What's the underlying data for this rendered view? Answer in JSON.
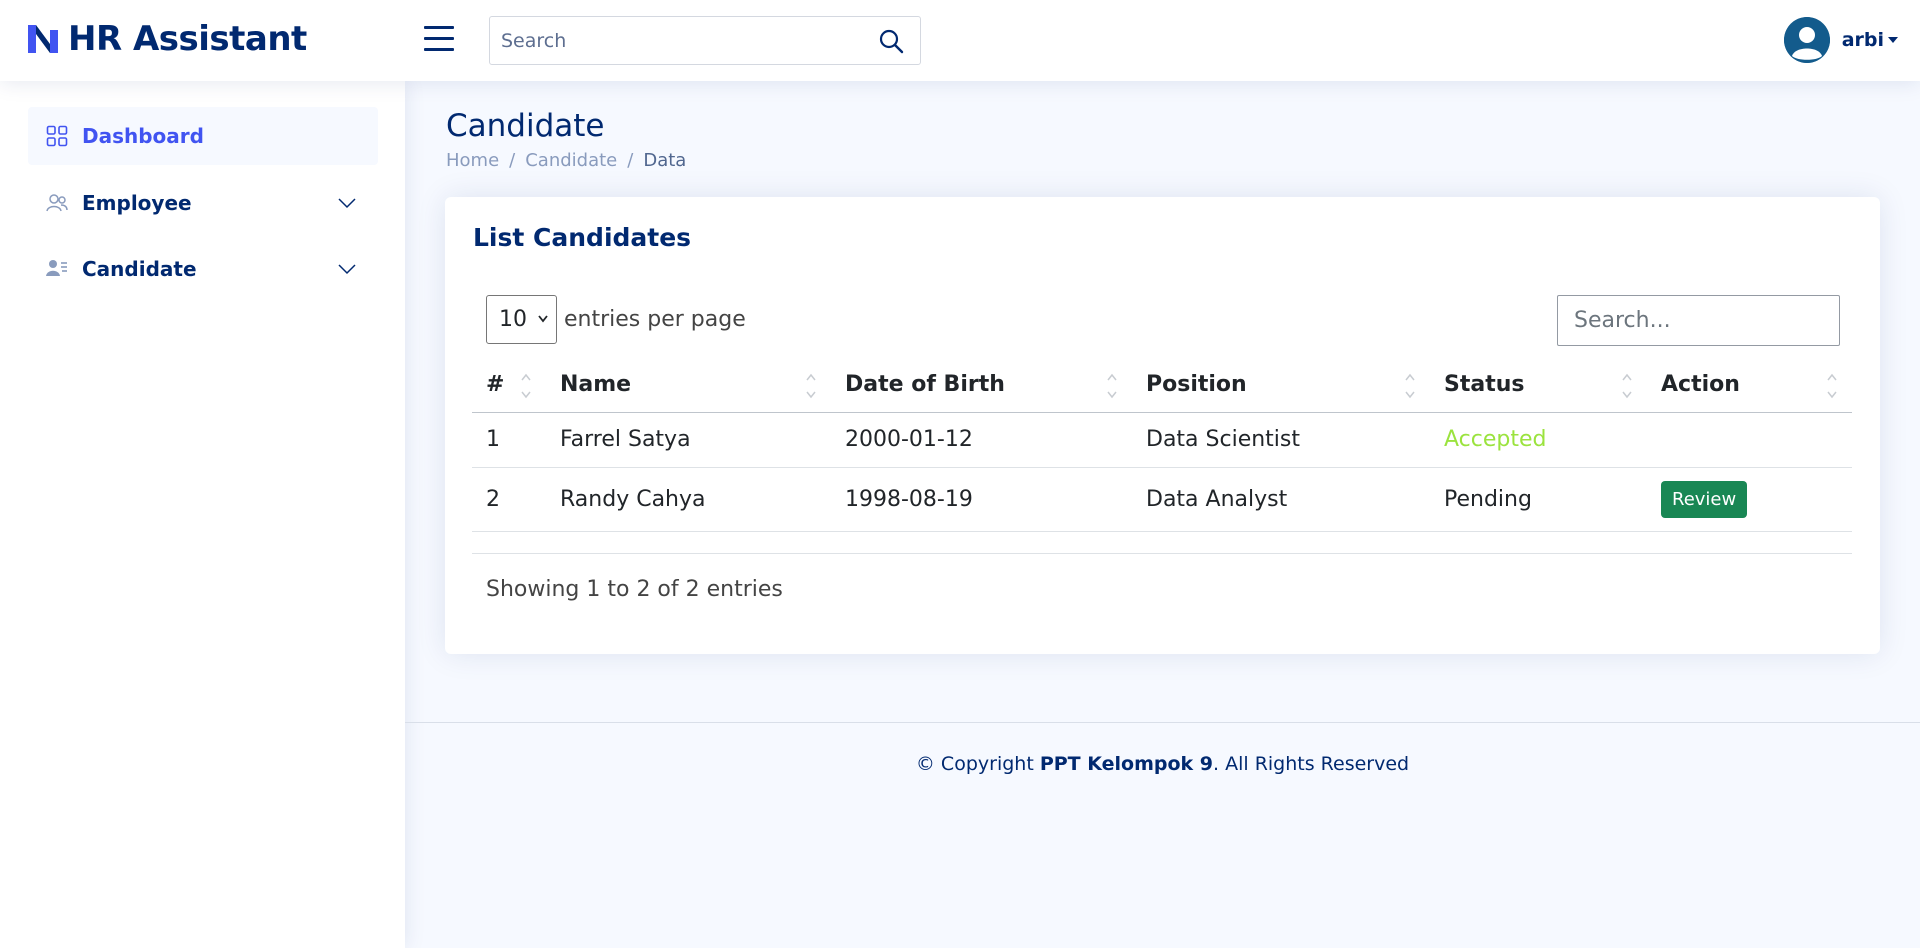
{
  "app": {
    "name": "HR Assistant",
    "brand_color": "#4154f1",
    "text_color": "#012970"
  },
  "header": {
    "search_placeholder": "Search",
    "search_icon": "search-icon",
    "menu_icon": "hamburger-icon",
    "user_name": "arbi"
  },
  "sidebar": {
    "items": [
      {
        "label": "Dashboard",
        "icon": "grid-icon",
        "active": true
      },
      {
        "label": "Employee",
        "icon": "people-icon",
        "expandable": true
      },
      {
        "label": "Candidate",
        "icon": "person-lines-icon",
        "expandable": true
      }
    ]
  },
  "page": {
    "title": "Candidate",
    "breadcrumb": [
      "Home",
      "Candidate",
      "Data"
    ]
  },
  "card": {
    "title": "List Candidates",
    "entries_value": "10",
    "entries_label": "entries per page",
    "search_placeholder": "Search...",
    "columns": [
      "#",
      "Name",
      "Date of Birth",
      "Position",
      "Status",
      "Action"
    ],
    "rows": [
      {
        "no": "1",
        "name": "Farrel Satya",
        "dob": "2000-01-12",
        "position": "Data Scientist",
        "status": "Accepted",
        "action": ""
      },
      {
        "no": "2",
        "name": "Randy Cahya",
        "dob": "1998-08-19",
        "position": "Data Analyst",
        "status": "Pending",
        "action": "Review"
      }
    ],
    "info": "Showing 1 to 2 of 2 entries",
    "status_colors": {
      "accepted": "#9be33e",
      "review_button": "#198754"
    }
  },
  "footer": {
    "prefix": "© Copyright ",
    "owner": "PPT Kelompok 9",
    "suffix": ". All Rights Reserved"
  }
}
